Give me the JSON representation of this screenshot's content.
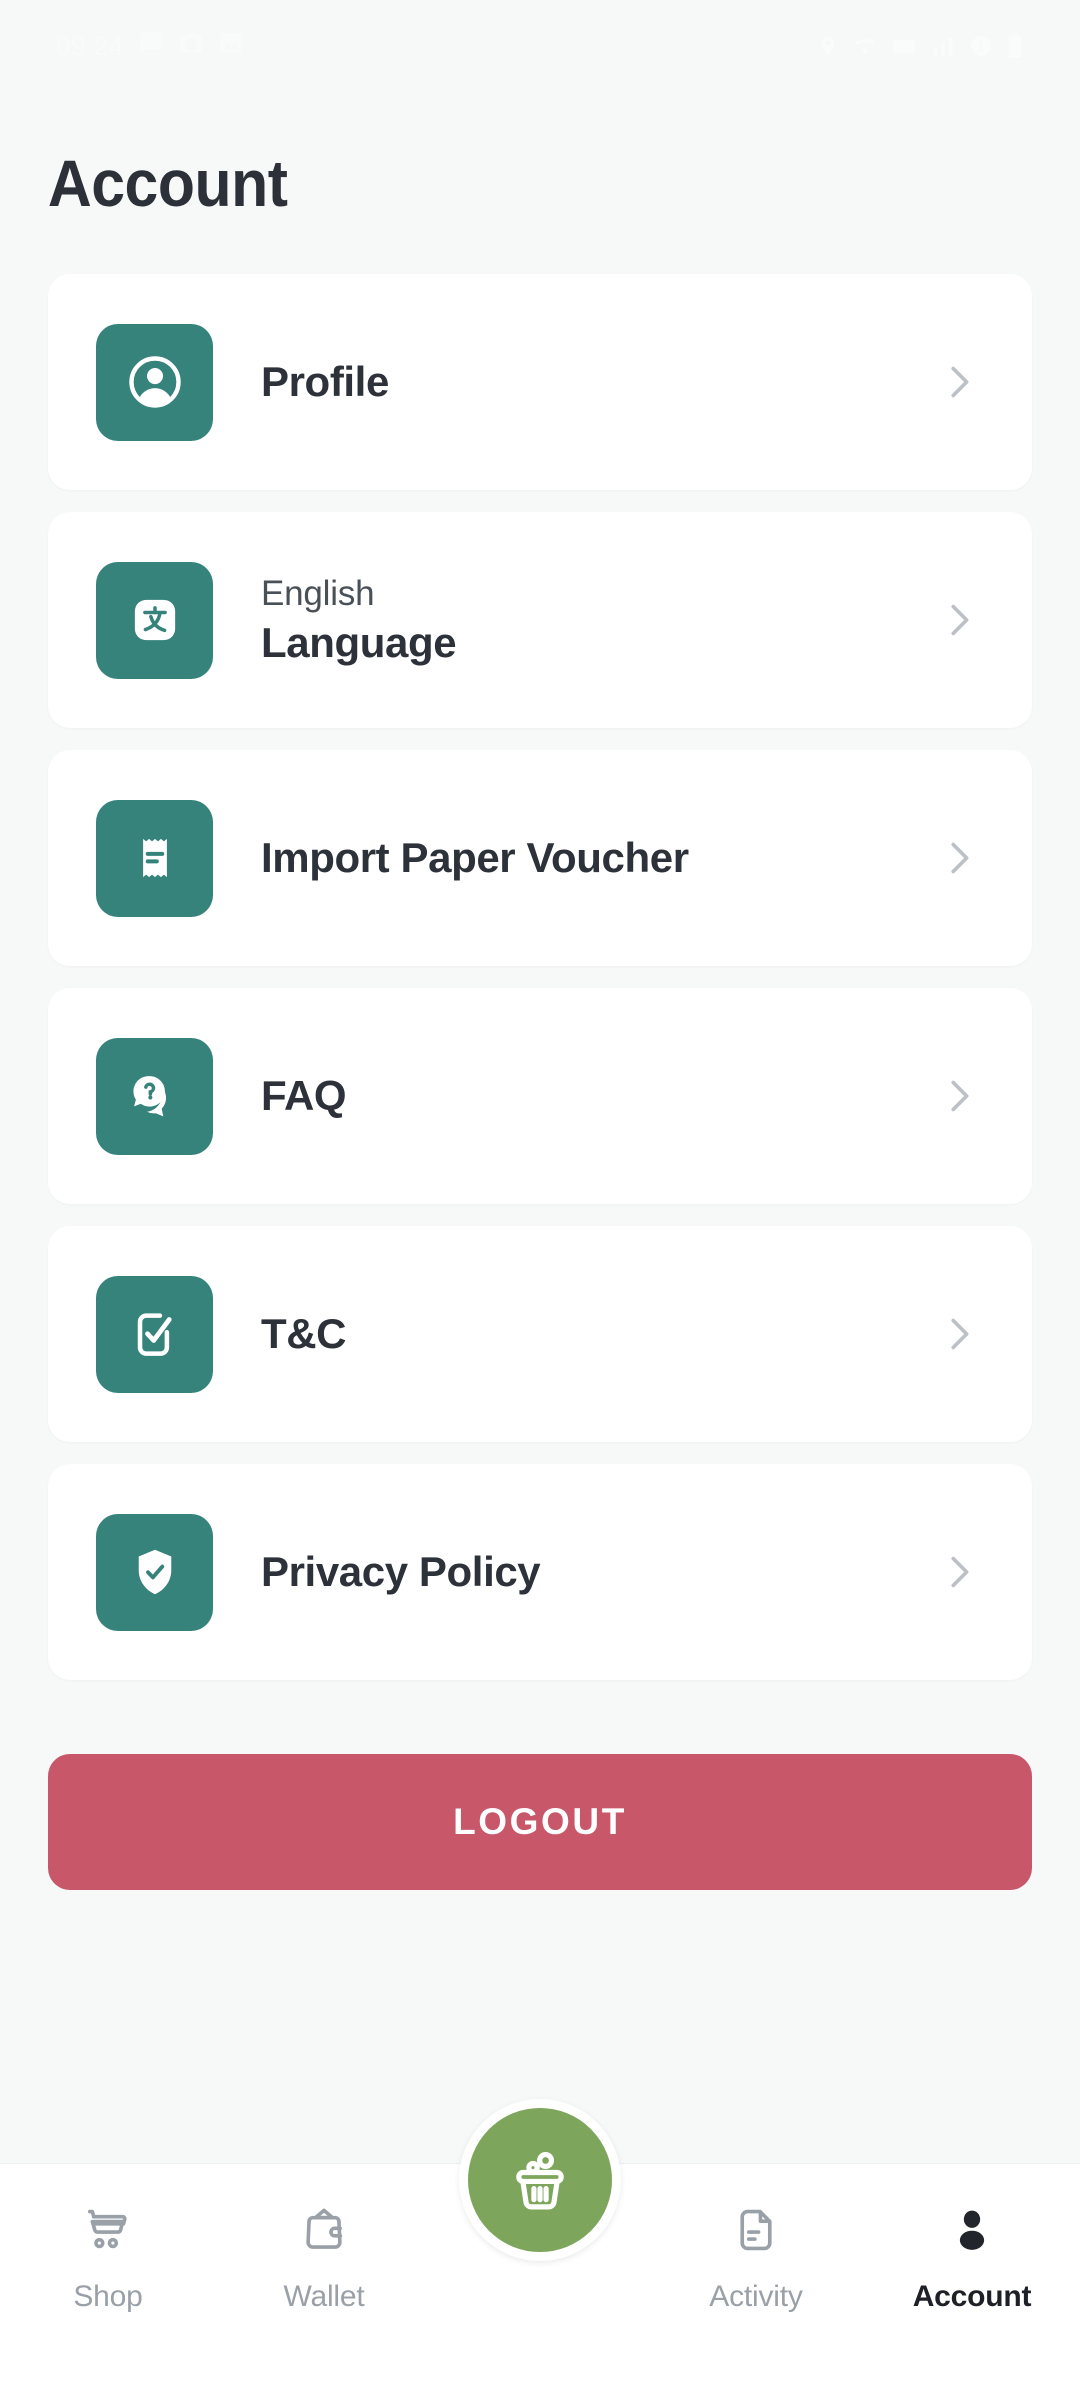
{
  "status_bar": {
    "time": "09:24",
    "left_icons": [
      "message-icon",
      "camera-icon",
      "gallery-icon"
    ],
    "right_icons": [
      "location-icon",
      "wifi-icon",
      "mobile-data-icon",
      "signal-icon",
      "vibrate-icon",
      "battery-icon"
    ]
  },
  "header": {
    "title": "Account"
  },
  "colors": {
    "page_background": "#f7f8f8",
    "card_background": "#ffffff",
    "icon_tile_teal": "#36837b",
    "logout_red": "#c9576a",
    "fab_green": "#7da65c",
    "chevron_gray": "#bcc1c7",
    "title_dark": "#2c3038",
    "muted_text": "#9aa0a8"
  },
  "menu": {
    "items": [
      {
        "id": "profile",
        "icon": "user-circle-icon",
        "subtitle": "",
        "title": "Profile",
        "chevron": "chevron-right-icon"
      },
      {
        "id": "language",
        "icon": "translate-icon",
        "subtitle": "English",
        "title": "Language",
        "chevron": "chevron-right-icon"
      },
      {
        "id": "import-paper-voucher",
        "icon": "receipt-icon",
        "subtitle": "",
        "title": "Import Paper Voucher",
        "chevron": "chevron-right-icon"
      },
      {
        "id": "faq",
        "icon": "question-chat-icon",
        "subtitle": "",
        "title": "FAQ",
        "chevron": "chevron-right-icon"
      },
      {
        "id": "tnc",
        "icon": "checked-document-icon",
        "subtitle": "",
        "title": "T&C",
        "chevron": "chevron-right-icon"
      },
      {
        "id": "privacy-policy",
        "icon": "shield-check-icon",
        "subtitle": "",
        "title": "Privacy Policy",
        "chevron": "chevron-right-icon"
      }
    ]
  },
  "logout": {
    "label": "LOGOUT"
  },
  "bottom_nav": {
    "items": [
      {
        "id": "shop",
        "label": "Shop",
        "icon": "shopping-cart-icon",
        "active": false
      },
      {
        "id": "wallet",
        "label": "Wallet",
        "icon": "wallet-icon",
        "active": false
      },
      {
        "id": "basket",
        "label": "",
        "icon": "basket-icon",
        "active": false
      },
      {
        "id": "activity",
        "label": "Activity",
        "icon": "activity-doc-icon",
        "active": false
      },
      {
        "id": "account",
        "label": "Account",
        "icon": "person-icon",
        "active": true
      }
    ]
  }
}
